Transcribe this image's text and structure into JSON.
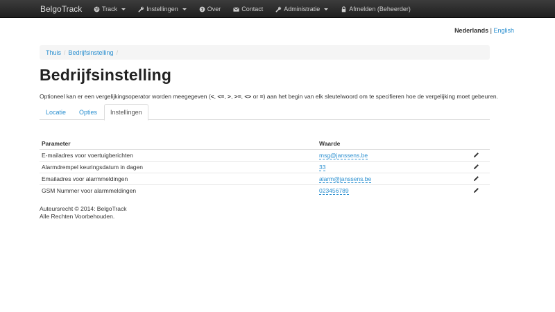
{
  "navbar": {
    "brand": "BelgoTrack",
    "items": [
      {
        "label": "Track",
        "icon": "globe-icon",
        "dropdown": true
      },
      {
        "label": "Instellingen",
        "icon": "wrench-icon",
        "dropdown": true
      },
      {
        "label": "Over",
        "icon": "question-icon",
        "dropdown": false
      },
      {
        "label": "Contact",
        "icon": "envelope-icon",
        "dropdown": false
      },
      {
        "label": "Administratie",
        "icon": "wrench-icon",
        "dropdown": true
      },
      {
        "label": "Afmelden (Beheerder)",
        "icon": "lock-icon",
        "dropdown": false
      }
    ]
  },
  "language": {
    "active": "Nederlands",
    "separator": "|",
    "other": "English"
  },
  "breadcrumb": {
    "items": [
      "Thuis",
      "Bedrijfsinstelling"
    ],
    "divider": "/"
  },
  "page": {
    "title": "Bedrijfsinstelling",
    "description_parts": [
      {
        "text": "Optioneel kan er een vergelijkingsoperator worden meegegeven (",
        "bold": false
      },
      {
        "text": "<",
        "bold": true
      },
      {
        "text": ", ",
        "bold": false
      },
      {
        "text": "<=",
        "bold": true
      },
      {
        "text": ", ",
        "bold": false
      },
      {
        "text": ">",
        "bold": true
      },
      {
        "text": ", ",
        "bold": false
      },
      {
        "text": ">=",
        "bold": true
      },
      {
        "text": ", ",
        "bold": false
      },
      {
        "text": "<>",
        "bold": true
      },
      {
        "text": " or ",
        "bold": false
      },
      {
        "text": "=",
        "bold": true
      },
      {
        "text": ") aan het begin van elk sleutelwoord om te specifieren hoe de vergelijking moet gebeuren.",
        "bold": false
      }
    ]
  },
  "tabs": [
    {
      "label": "Locatie",
      "active": false
    },
    {
      "label": "Opties",
      "active": false
    },
    {
      "label": "Instellingen",
      "active": true
    }
  ],
  "table": {
    "headers": [
      "Parameter",
      "Waarde",
      ""
    ],
    "rows": [
      {
        "parameter": "E-mailadres voor voertuigberichten",
        "value": "msg@janssens.be"
      },
      {
        "parameter": "Alarmdrempel keuringsdatum in dagen",
        "value": "33"
      },
      {
        "parameter": "Emailadres voor alarmmeldingen",
        "value": "alarm@janssens.be"
      },
      {
        "parameter": "GSM Nummer voor alarmmeldingen",
        "value": "023456789"
      }
    ]
  },
  "footer": {
    "line1": "Auteursrecht © 2014: BelgoTrack",
    "line2": "Alle Rechten Voorbehouden."
  },
  "colors": {
    "navbar": "#222222",
    "link": "#2a8fd0",
    "text": "#333333"
  }
}
